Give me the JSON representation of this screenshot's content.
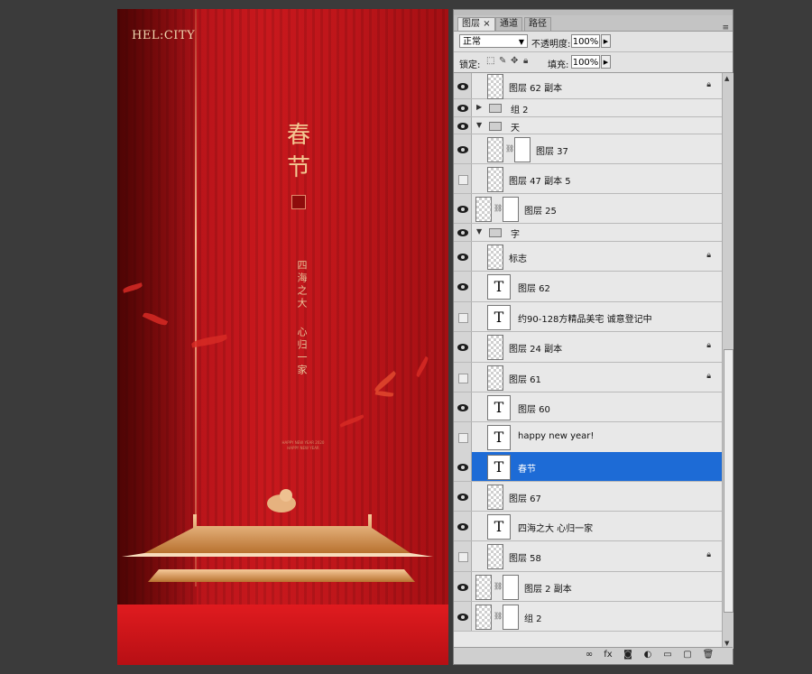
{
  "poster": {
    "brand": "HEL:CITY",
    "title": "春节",
    "vertical_text_1": "四海之大",
    "vertical_text_2": "心归一家",
    "small_print_1": "HAPPY NEW YEAR 2020",
    "small_print_2": "HAPPY NEW YEAR",
    "colors": {
      "background": "#c8181d",
      "gold": "#f3c792"
    }
  },
  "panel": {
    "tabs": [
      "图层",
      "通道",
      "路径"
    ],
    "tab_close": "×",
    "blend_mode": "正常",
    "opacity_label": "不透明度:",
    "opacity_value": "100%",
    "lock_label": "锁定:",
    "fill_label": "填充:",
    "fill_value": "100%"
  },
  "layers": [
    {
      "name": "图层 62 副本",
      "visible": true,
      "type": "pixel",
      "locked": true
    },
    {
      "name": "组 2",
      "visible": true,
      "type": "group",
      "expanded": false
    },
    {
      "name": "天",
      "visible": true,
      "type": "group",
      "expanded": true
    },
    {
      "name": "图层 37",
      "visible": true,
      "type": "masked",
      "indent": true
    },
    {
      "name": "图层 47 副本 5",
      "visible": false,
      "type": "pixel",
      "indent": true
    },
    {
      "name": "图层 25",
      "visible": true,
      "type": "masked-thumb"
    },
    {
      "name": "字",
      "visible": true,
      "type": "group",
      "expanded": true
    },
    {
      "name": "标志",
      "visible": true,
      "type": "pixel",
      "locked": true
    },
    {
      "name": "图层 62",
      "visible": true,
      "type": "text"
    },
    {
      "name": "约90-128方精品美宅 诚意登记中",
      "visible": false,
      "type": "text"
    },
    {
      "name": "图层 24 副本",
      "visible": true,
      "type": "pixel",
      "locked": true
    },
    {
      "name": "图层 61",
      "visible": false,
      "type": "pixel",
      "locked": true
    },
    {
      "name": "图层 60",
      "visible": true,
      "type": "text"
    },
    {
      "name": "happy new year!",
      "visible": false,
      "type": "text"
    },
    {
      "name": "春节",
      "visible": true,
      "type": "text",
      "selected": true
    },
    {
      "name": "图层 67",
      "visible": true,
      "type": "pixel"
    },
    {
      "name": "四海之大 心归一家",
      "visible": true,
      "type": "text"
    },
    {
      "name": "图层 58",
      "visible": false,
      "type": "pixel",
      "locked": true
    },
    {
      "name": "图层 2 副本",
      "visible": true,
      "type": "masked-thumb"
    },
    {
      "name": "组 2",
      "visible": true,
      "type": "masked-thumb"
    }
  ],
  "bottom_buttons": [
    "link-icon",
    "fx-icon",
    "mask-icon",
    "adjustment-icon",
    "new-group-icon",
    "new-layer-icon",
    "delete-icon"
  ],
  "bottom_glyphs": [
    "∞",
    "fx",
    "◙",
    "◐",
    "▭",
    "▢",
    "🗑"
  ]
}
